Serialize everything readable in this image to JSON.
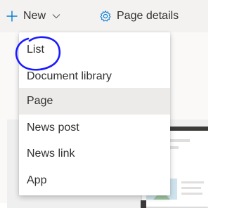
{
  "command_bar": {
    "new_label": "New",
    "page_details_label": "Page details"
  },
  "menu": {
    "items": [
      {
        "label": "List"
      },
      {
        "label": "Document library"
      },
      {
        "label": "Page"
      },
      {
        "label": "News post"
      },
      {
        "label": "News link"
      },
      {
        "label": "App"
      }
    ]
  },
  "colors": {
    "command_bar_bg": "#f3f2f1",
    "text": "#323130",
    "accent": "#0078d4",
    "hover_bg": "#edebe9",
    "annotation": "#1a1aff"
  }
}
